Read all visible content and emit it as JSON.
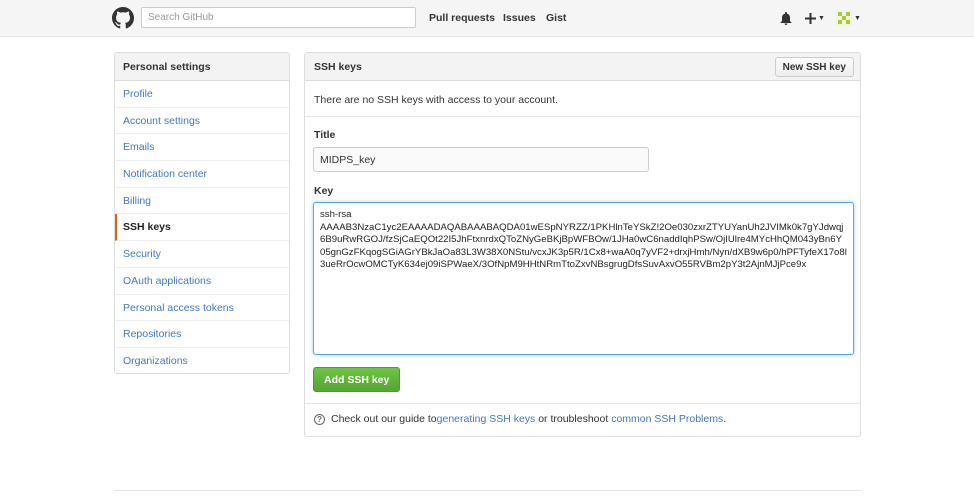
{
  "header": {
    "search_placeholder": "Search GitHub",
    "nav": [
      "Pull requests",
      "Issues",
      "Gist"
    ],
    "icons": [
      "github-logo",
      "bell-icon",
      "plus-icon",
      "avatar"
    ]
  },
  "sidebar": {
    "title": "Personal settings",
    "items": [
      {
        "label": "Profile"
      },
      {
        "label": "Account settings"
      },
      {
        "label": "Emails"
      },
      {
        "label": "Notification center"
      },
      {
        "label": "Billing"
      },
      {
        "label": "SSH keys",
        "active": true
      },
      {
        "label": "Security"
      },
      {
        "label": "OAuth applications"
      },
      {
        "label": "Personal access tokens"
      },
      {
        "label": "Repositories"
      },
      {
        "label": "Organizations"
      }
    ]
  },
  "main": {
    "title": "SSH keys",
    "new_button": "New SSH key",
    "empty_message": "There are no SSH keys with access to your account.",
    "title_label": "Title",
    "title_value": "MIDPS_key",
    "key_label": "Key",
    "key_value": "ssh-rsa\nAAAAB3NzaC1yc2EAAAADAQABAAABAQDA01wESpNYRZZ/1PKHlnTeYSkZ!2Oe030zxrZTYUYanUh2JVIMk0k7gYJdwqj6B9uRwRGOJ/fzSjCaEQOt22I5JhFtxnrdxQToZNyGeBKjBpWFBOw/1JHa0wC6naddIqhPSw/OjIUlre4MYcHhQM043yBn6Y05gnGzFKqogSGiAGrYBkJaOa83L3W38X0NStu/vcxJK3p5R/1Cx8+waA0q7yVF2+drxjHmh/Nyn/dXB9w6p0/hPFTyfeX17o8l3ueRrOcwOMCTyK634ej09iSPWaeX/3OfNpM9HHtNRmTtoZxvNBsgrugDfsSuvAxvO55RVBm2pY3t2AjnMJjPce9x",
    "add_button": "Add SSH key",
    "help": {
      "prefix": "Check out our guide to ",
      "link1": "generating SSH keys",
      "middle": " or troubleshoot ",
      "link2": "common SSH Problems",
      "suffix": "."
    }
  },
  "colors": {
    "link": "#4078c0",
    "active_accent": "#d26911",
    "green_button": "#55a532",
    "focus_border": "#51a7e8"
  }
}
